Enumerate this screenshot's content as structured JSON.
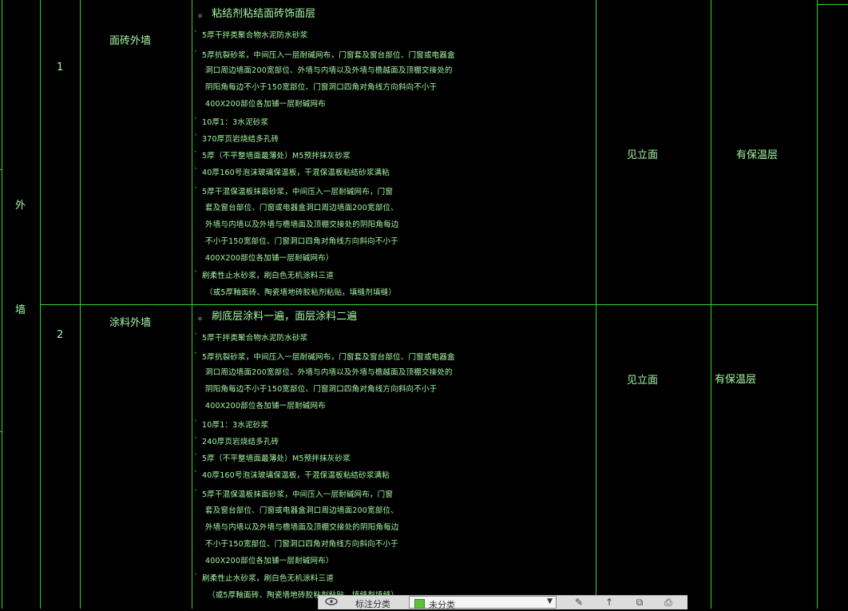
{
  "category": {
    "left_char_1": "外",
    "left_char_2": "墙"
  },
  "rows": [
    {
      "index": "1",
      "name": "面砖外墙",
      "title": "。  粘结剂粘结面砖饰面层",
      "lines": [
        "5厚干拌类聚合物水泥防水砂浆",
        "5厚抗裂砂浆，中间压入一层耐碱网布，门窗套及窗台部位、门窗或电器盒",
        "洞口周边墙面200宽部位、外墙与内墙以及外墙与檐越面及顶棚交接处的",
        "阴阳角每边不小于150宽部位、门窗洞口四角对角线方向斜向不小于",
        "400X200部位各加铺一层耐碱网布",
        "10厚1：3水泥砂浆",
        "370厚页岩烧结多孔砖",
        "5厚（不平整墙面最薄处）M5预拌抹灰砂浆",
        "40厚160号泡沫玻璃保温板，干混保温板粘结砂浆满粘",
        "5厚干混保温板抹面砂浆，中间压入一层耐碱网布，门窗",
        "套及窗台部位、门窗或电器盒洞口周边墙面200宽部位、",
        "外墙与内墙以及外墙与檐墙面及顶棚交接处的阴阳角每边",
        "不小于150宽部位、门窗洞口四角对角线方向斜向不小于",
        "400X200部位各加铺一层耐碱网布）",
        "刷柔性止水砂浆，刷白色无机涂料三道",
        "（或5厚釉面砖、陶瓷墙地砖胶粘剂粘贴，填缝剂填缝）"
      ],
      "facade": "见立面",
      "insulation": "有保温层"
    },
    {
      "index": "2",
      "name": "涂料外墙",
      "title": "。  刷底层涂料一遍，面层涂料二遍",
      "lines": [
        "5厚干拌类聚合物水泥防水砂浆",
        "5厚抗裂砂浆，中间压入一层耐碱网布，门窗套及窗台部位、门窗或电器盒",
        "洞口周边墙面200宽部位、外墙与内墙以及外墙与檐越面及顶棚交接处的",
        "阴阳角每边不小于150宽部位、门窗洞口四角对角线方向斜向不小于",
        "400X200部位各加铺一层耐碱网布",
        "10厚1：3水泥砂浆",
        "240厚页岩烧结多孔砖",
        "5厚（不平整墙面最薄处）M5预拌抹灰砂浆",
        "40厚160号泡沫玻璃保温板，干混保温板粘结砂浆满粘",
        "5厚干混保温板抹面砂浆，中间压入一层耐碱网布，门窗",
        "套及窗台部位、门窗或电器盒洞口周边墙面200宽部位、",
        "外墙与内墙以及外墙与檐墙面及顶棚交接处的阴阳角每边",
        "不小于150宽部位、门窗洞口四角对角线方向斜向不小于",
        "400X200部位各加铺一层耐碱网布）",
        "刷柔性止水砂浆，刷白色无机涂料三道",
        "（或5厚釉面砖、陶瓷墙地砖胶粘剂粘贴，填缝剂填缝）"
      ],
      "facade": "见立面",
      "insulation": "有保温层"
    }
  ],
  "toolbar": {
    "group_label": "标注分类",
    "layer_name": "未分类",
    "layer_color": "#5fbf3f",
    "icons": [
      "eye-icon",
      "pen-icon",
      "arrow-up-icon",
      "copy-icon",
      "print-icon"
    ]
  }
}
